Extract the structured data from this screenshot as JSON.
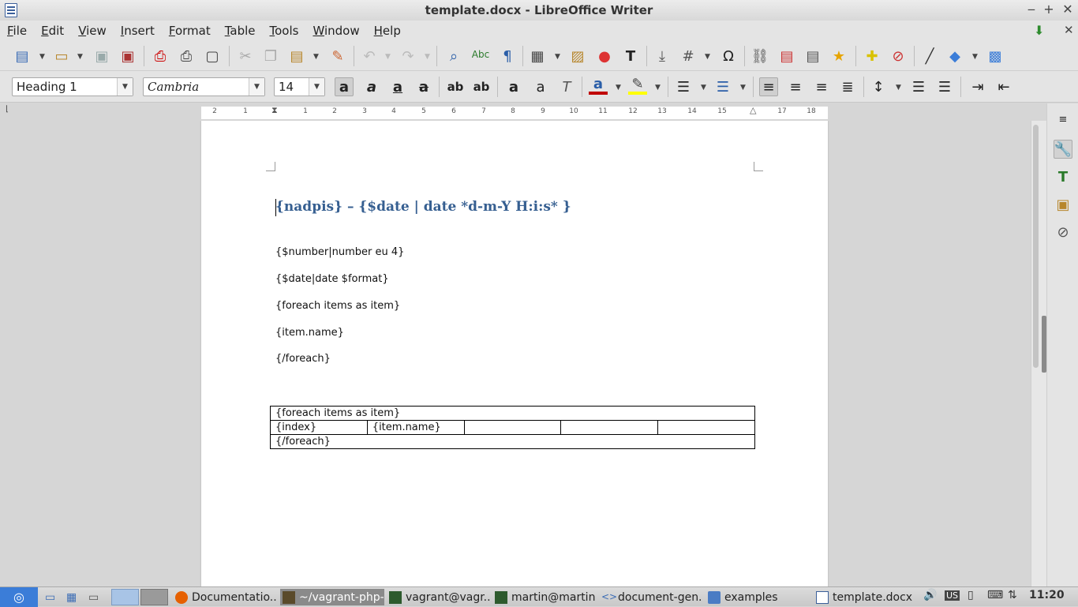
{
  "window": {
    "title": "template.docx - LibreOffice Writer",
    "minimize": "‒",
    "maximize": "+",
    "close": "✕"
  },
  "menu": [
    "File",
    "Edit",
    "View",
    "Insert",
    "Format",
    "Table",
    "Tools",
    "Window",
    "Help"
  ],
  "format_bar": {
    "paragraph_style": "Heading 1",
    "font_name": "Cambria",
    "font_size": "14"
  },
  "ruler_ticks": [
    "2",
    "1",
    "1",
    "2",
    "3",
    "4",
    "5",
    "6",
    "7",
    "8",
    "9",
    "10",
    "11",
    "12",
    "13",
    "14",
    "15",
    "16",
    "17",
    "18"
  ],
  "document": {
    "heading": "{nadpis} – {$date | date *d-m-Y H:i:s* }",
    "paragraphs": [
      "{$number|number eu 4}",
      "{$date|date $format}",
      "{foreach items as item}",
      "{item.name}",
      "{/foreach}"
    ],
    "table": {
      "row1": "{foreach items as item}",
      "row2": [
        "{index}",
        "{item.name}",
        "",
        "",
        ""
      ],
      "row3": "{/foreach}"
    }
  },
  "taskbar": {
    "items": [
      "Documentatio...",
      "~/vagrant-php-...",
      "vagrant@vagr...",
      "martin@martin...",
      "document-gen...",
      "examples",
      "template.docx ..."
    ],
    "keyboard_layout": "US",
    "clock": "11:20"
  },
  "colors": {
    "heading": "#365f91",
    "font_color": "#c00000",
    "highlight": "#ffff00",
    "accent": "#4a90d9"
  }
}
